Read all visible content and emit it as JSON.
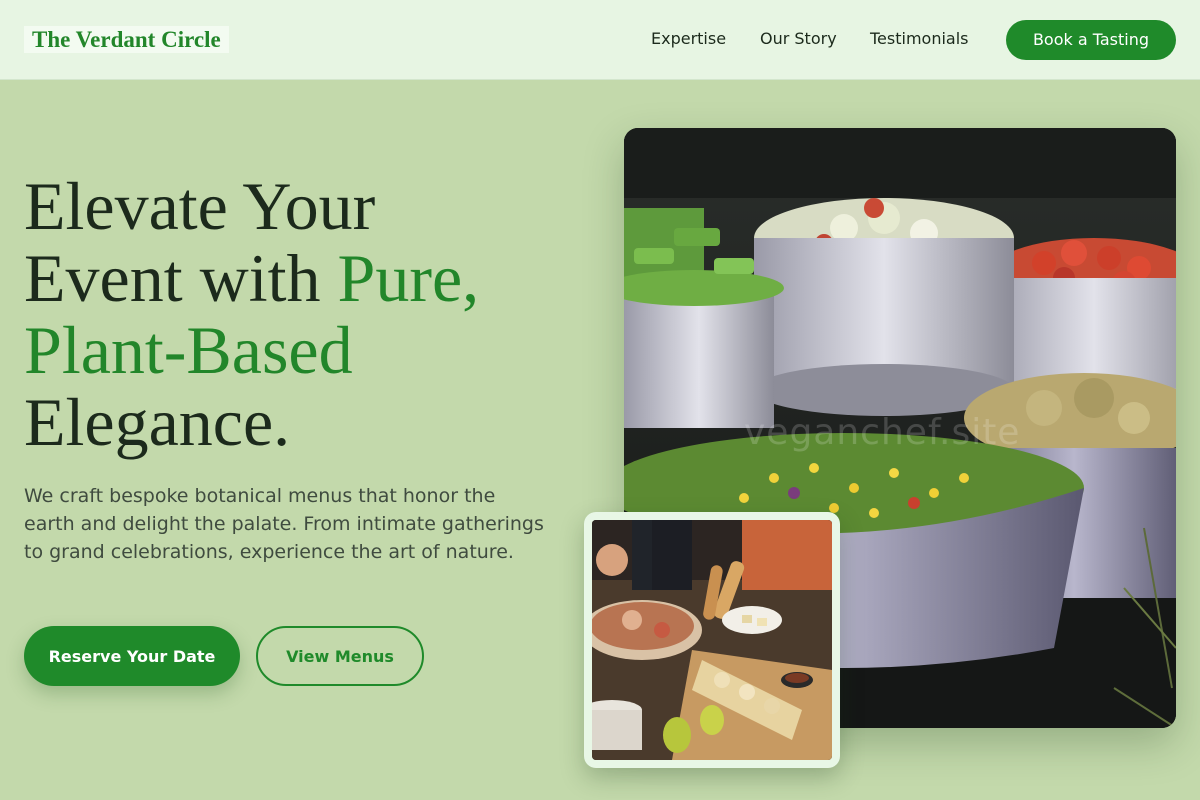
{
  "header": {
    "logo": "The Verdant Circle",
    "nav": [
      "Expertise",
      "Our Story",
      "Testimonials"
    ],
    "cta": "Book a Tasting"
  },
  "hero": {
    "title_line1": "Elevate Your",
    "title_line2_plain": "Event with ",
    "title_line2_accent": "Pure,",
    "title_line3_accent": "Plant-Based",
    "title_line4": "Elegance.",
    "description": "We craft bespoke botanical menus that honor the earth and delight the palate. From intimate gatherings to grand celebrations, experience the art of nature.",
    "primary_button": "Reserve Your Date",
    "secondary_button": "View Menus"
  },
  "images": {
    "main_watermark": "veganchef.site"
  },
  "colors": {
    "accent": "#1f8a2a",
    "background": "#c3d9ab",
    "header_bg": "#e7f5e3",
    "text": "#1c2a1c"
  }
}
